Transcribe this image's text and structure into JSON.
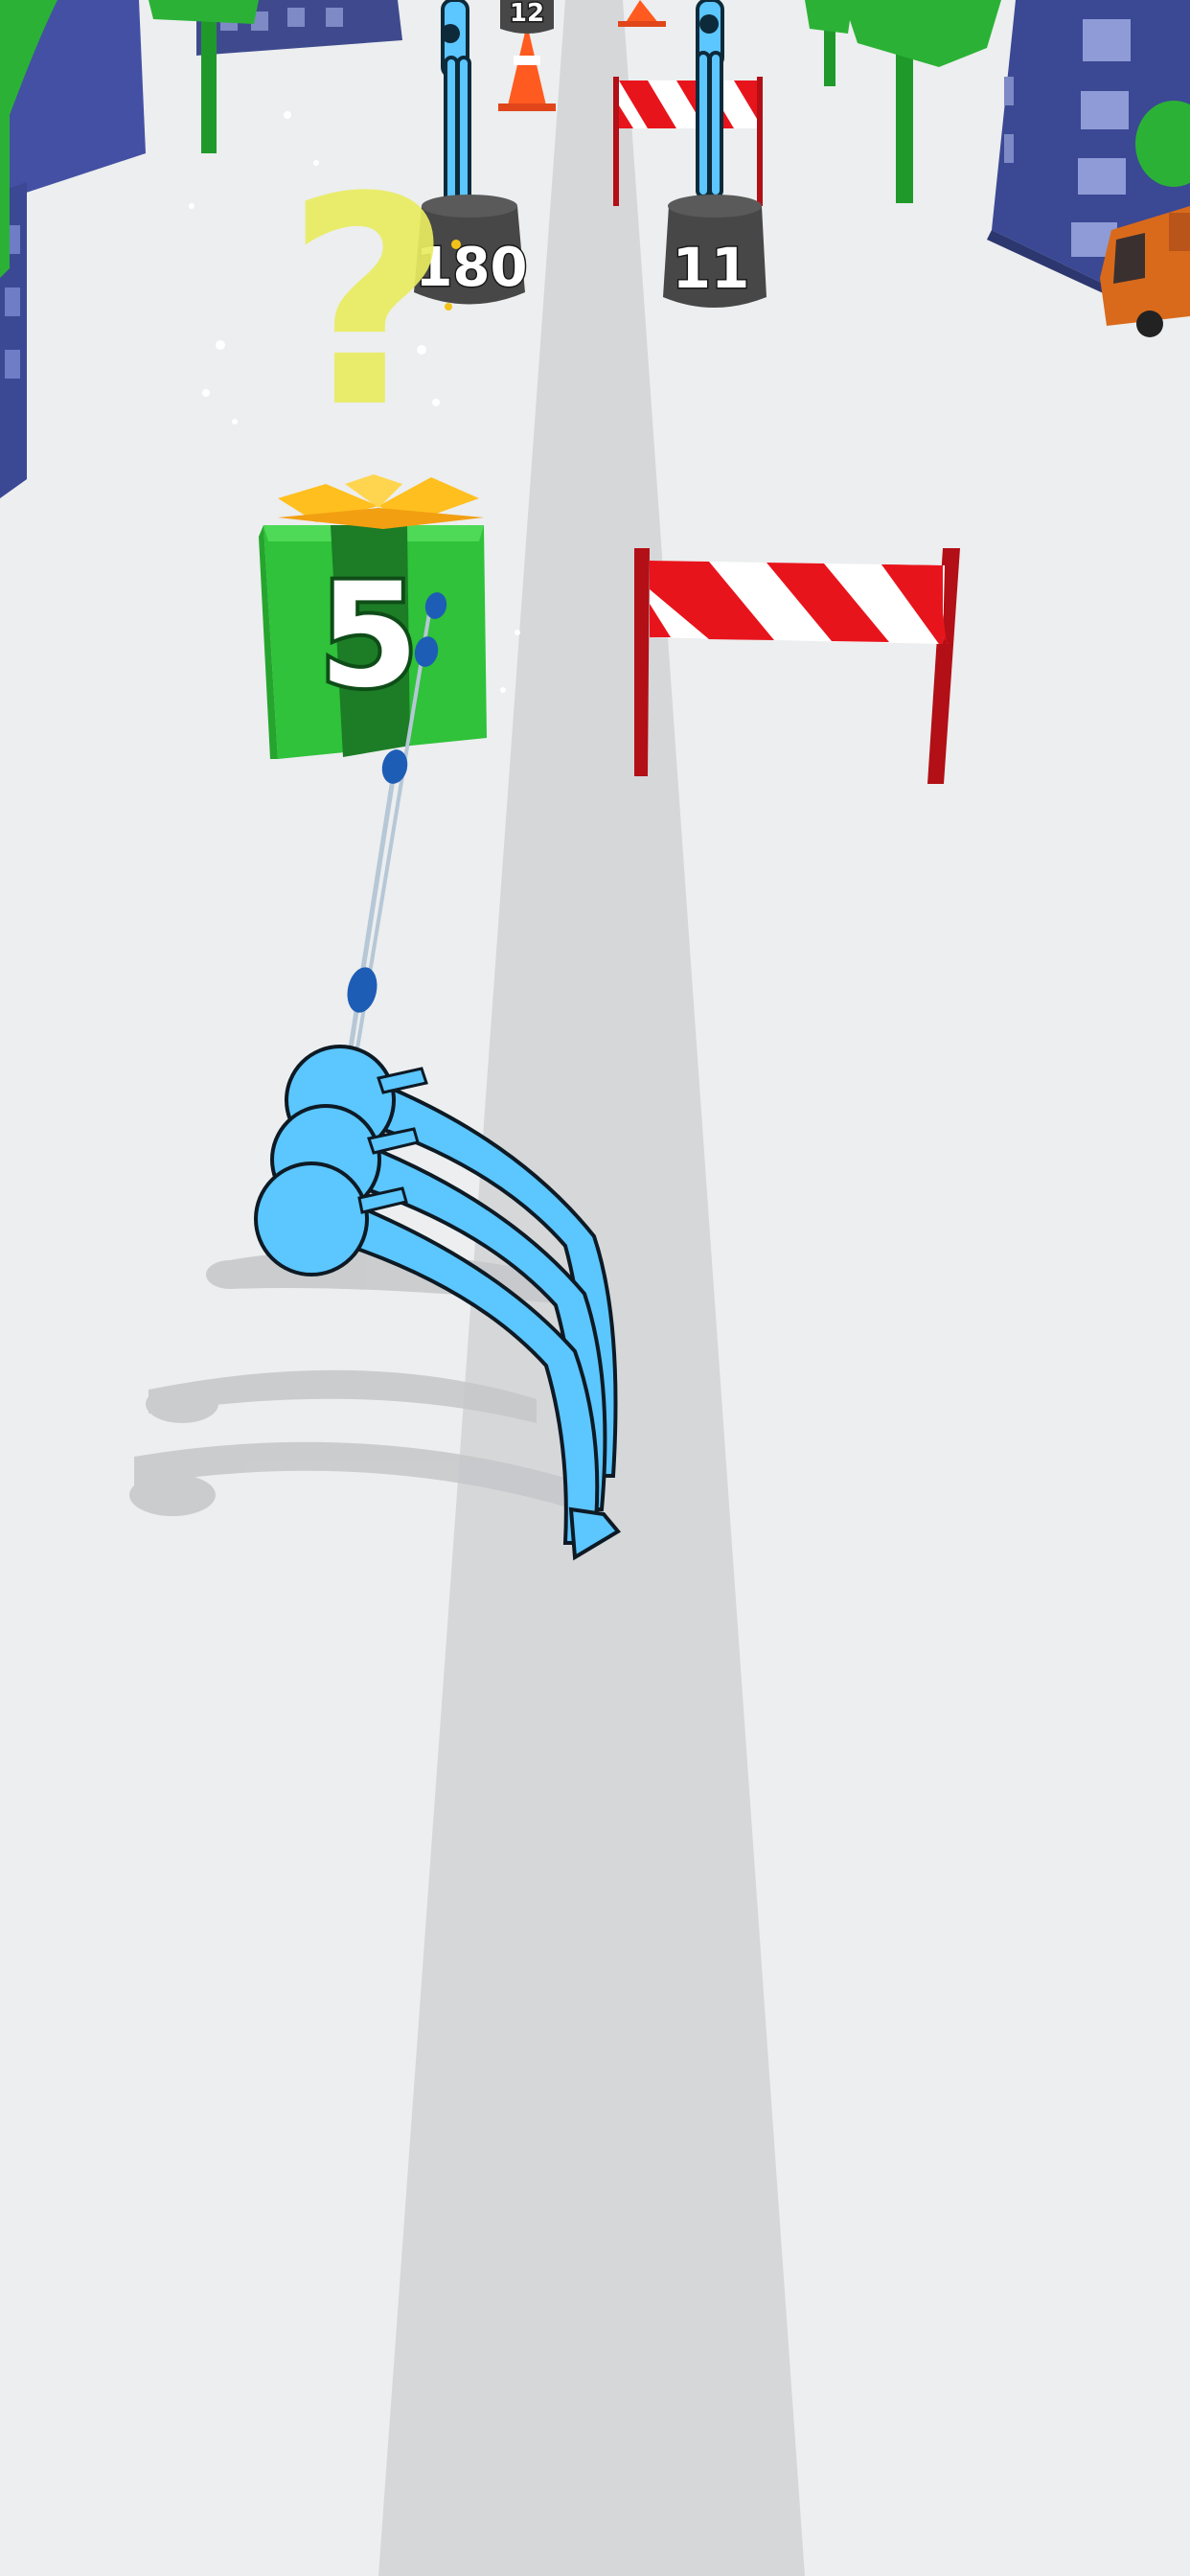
{
  "game": {
    "gift_box_value": "5",
    "mystery_symbol": "?",
    "obstacles": [
      {
        "label": "12"
      },
      {
        "label": "180"
      },
      {
        "label": "11"
      }
    ]
  },
  "colors": {
    "ground": "#eceeef",
    "track": "#d6d7d9",
    "player": "#5cc6ff",
    "gift_green": "#2fc23a",
    "gift_ribbon": "#1c7d26",
    "bow": "#ffbf1f",
    "mystery": "#e9ec60",
    "barrier_red": "#e8141c",
    "post_red": "#b20f16",
    "weight_block": "#4a4a4a",
    "building_blue": "#3b4894",
    "tree_green": "#2bb236",
    "truck_orange": "#d96a1b"
  }
}
